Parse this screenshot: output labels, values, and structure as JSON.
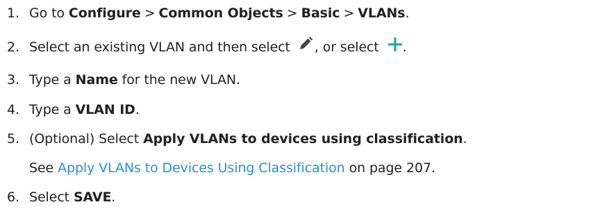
{
  "steps": [
    {
      "number": "1.",
      "lead": "Go to ",
      "path": [
        "Configure",
        "Common Objects",
        "Basic",
        "VLANs"
      ],
      "separator": ">",
      "end": "."
    },
    {
      "number": "2.",
      "text_a": "Select an existing VLAN and then select ",
      "edit_icon": "pencil-edit-icon",
      "text_b": ", or select ",
      "add_icon": "plus-add-icon",
      "end": "."
    },
    {
      "number": "3.",
      "lead": "Type a ",
      "bold": "Name",
      "tail": " for the new VLAN."
    },
    {
      "number": "4.",
      "lead": "Type a ",
      "bold": "VLAN ID",
      "tail": "."
    },
    {
      "number": "5.",
      "lead": "(Optional) Select ",
      "bold": "Apply VLANs to devices using classification",
      "tail": ".",
      "see_lead": "See ",
      "link_text": "Apply VLANs to Devices Using Classification",
      "see_tail": " on page 207."
    },
    {
      "number": "6.",
      "lead": "Select ",
      "bold": "SAVE",
      "tail": "."
    }
  ],
  "colors": {
    "text": "#222222",
    "link": "#2a8fd6",
    "pencil_icon": "#444444",
    "plus_icon": "#1e9bb0"
  }
}
